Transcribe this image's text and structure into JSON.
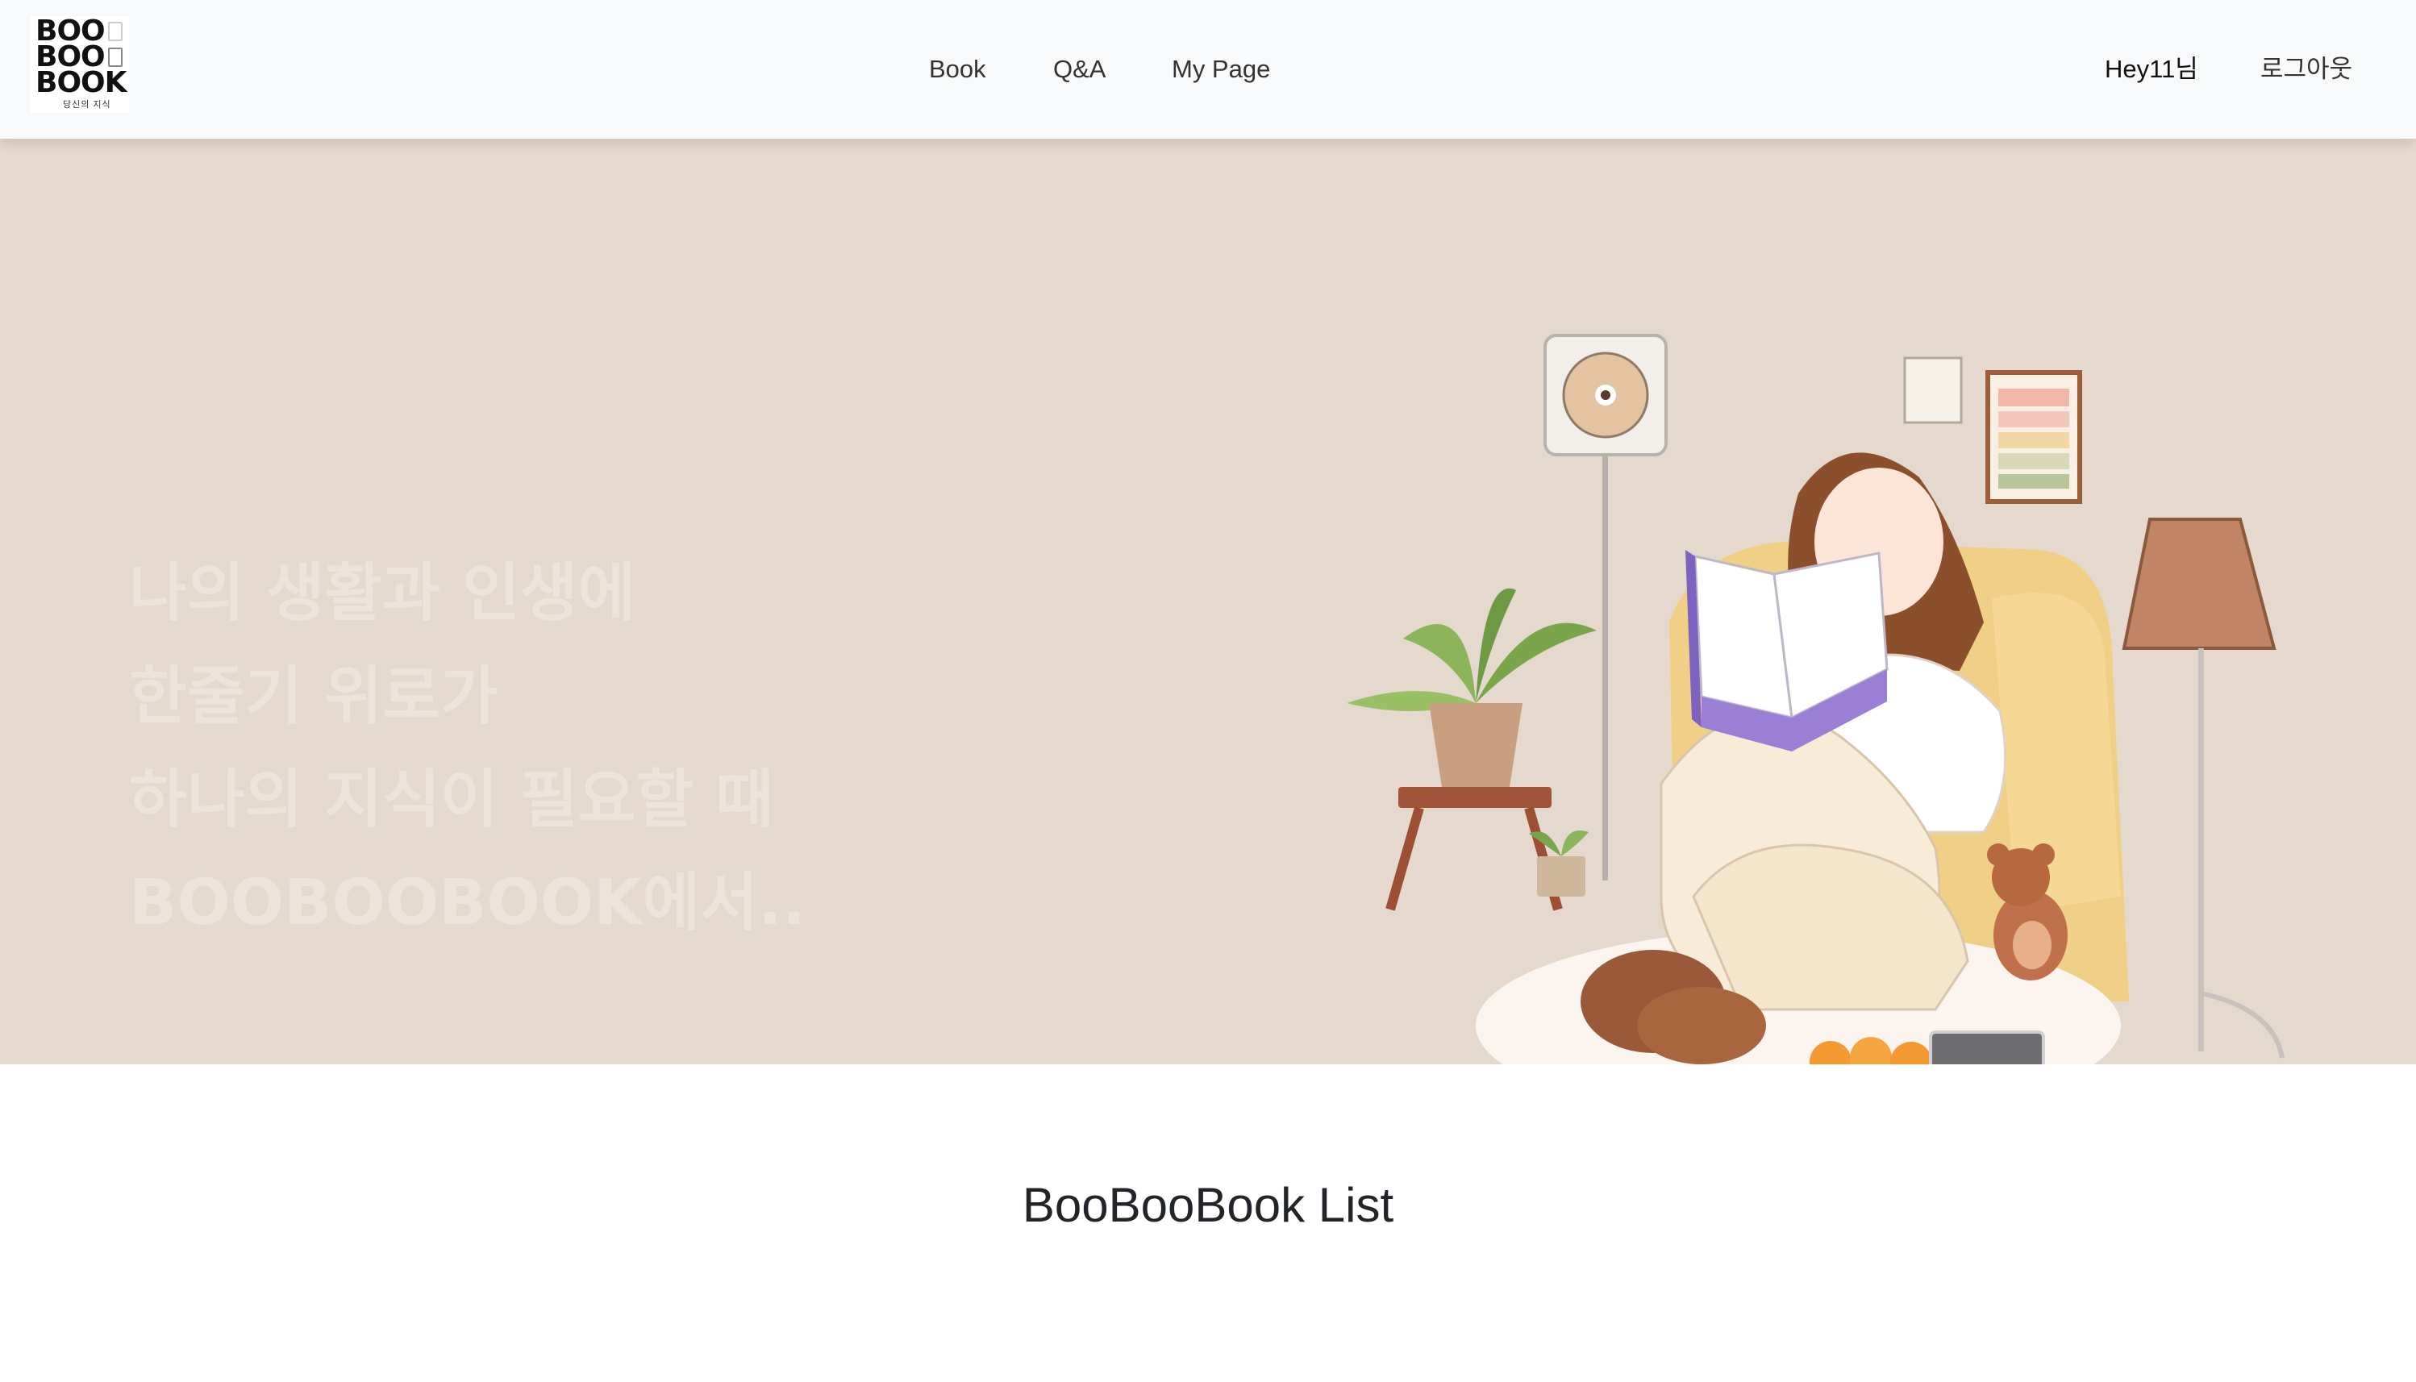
{
  "header": {
    "logo": {
      "lines": [
        "BOO",
        "BOO",
        "BOOK"
      ],
      "subtitle": "당신의 지식"
    },
    "nav": [
      {
        "label": "Book"
      },
      {
        "label": "Q&A"
      },
      {
        "label": "My Page"
      }
    ],
    "user_greeting": "Hey11님",
    "logout_label": "로그아웃"
  },
  "hero": {
    "lines": [
      "나의 생활과 인생에",
      "한줄기 위로가",
      "하나의 지식이 필요할 때",
      "BOOBOOBOOK에서.."
    ]
  },
  "section": {
    "title": "BooBooBook List"
  },
  "colors": {
    "header_bg": "#f8f9fa",
    "hero_bg": "#e5d8cc",
    "hero_text": "#ece3da",
    "book_purple": "#9b7fd4"
  }
}
